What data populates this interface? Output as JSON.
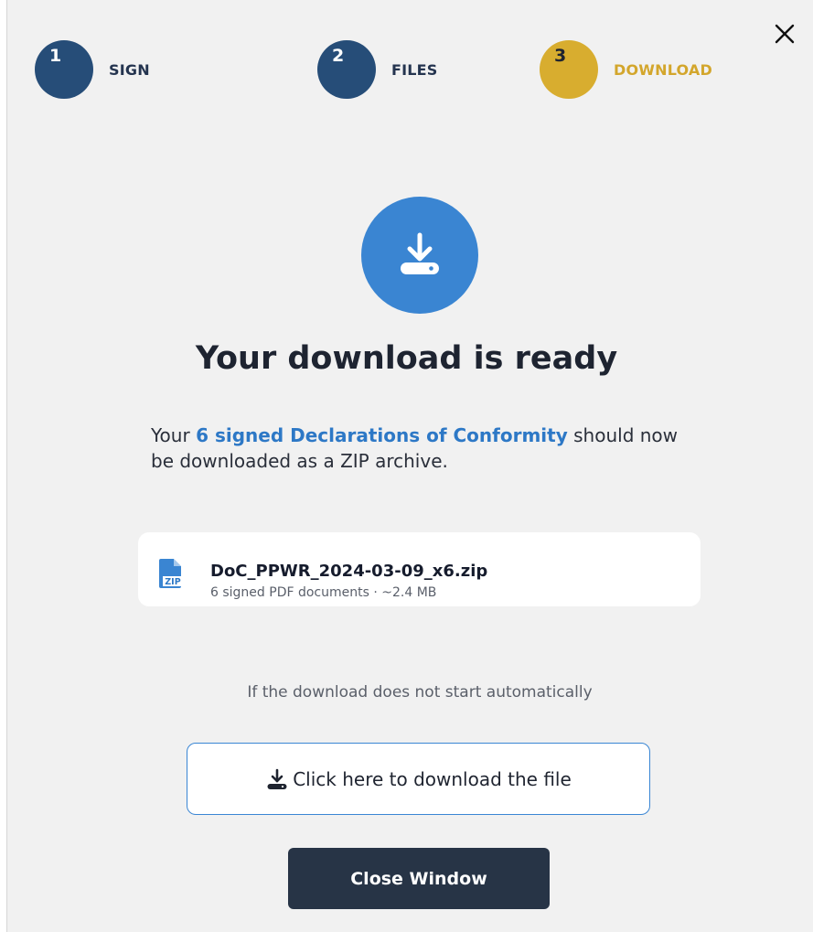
{
  "steps": [
    {
      "number": "1",
      "label": "SIGN",
      "color": "#264d78",
      "label_color": "#24344f"
    },
    {
      "number": "2",
      "label": "FILES",
      "color": "#264d78",
      "label_color": "#24344f"
    },
    {
      "number": "3",
      "label": "DOWNLOAD",
      "color": "#d8ad2f",
      "label_color": "#d3a62c"
    }
  ],
  "header": {
    "close_icon": "close-icon"
  },
  "hero": {
    "icon": "download-icon",
    "color": "#3a85d2"
  },
  "title": "Your download is ready",
  "description": {
    "prefix": "Your ",
    "highlight": "6 signed Declarations of Conformity",
    "suffix": " should now be downloaded as a ZIP archive."
  },
  "file": {
    "icon": "zip-file-icon",
    "icon_badge": "ZIP",
    "name": "DoC_PPWR_2024-03-09_x6.zip",
    "meta": "6 signed PDF documents · ~2.4 MB"
  },
  "hint": "If the download does not start automatically",
  "download_button": {
    "label": "Click here to download the file",
    "icon": "download-icon"
  },
  "close_button": {
    "label": "Close Window"
  },
  "colors": {
    "accent": "#3a85d2",
    "dark": "#273446",
    "active_step": "#d8ad2f",
    "background": "#f1f1f1"
  }
}
